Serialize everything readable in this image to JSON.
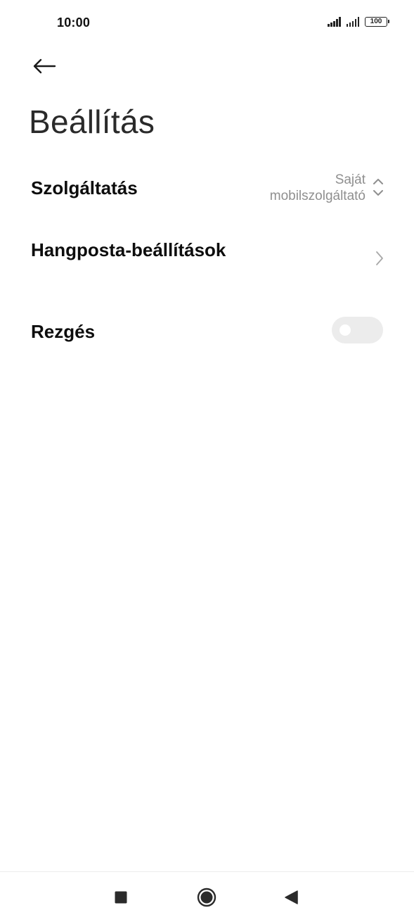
{
  "status_bar": {
    "time": "10:00",
    "battery": "100",
    "icons": [
      "signal-icon",
      "signal-icon",
      "battery-icon"
    ]
  },
  "header": {
    "back_icon": "arrow-left-icon",
    "title": "Beállítás"
  },
  "settings": {
    "service": {
      "label": "Szolgáltatás",
      "value_line1": "Saját",
      "value_line2": "mobilszolgáltató",
      "icon": "chevron-up-down-icon"
    },
    "voicemail": {
      "label": "Hangposta-beállítások",
      "icon": "chevron-right-icon"
    },
    "vibration": {
      "label": "Rezgés",
      "enabled": false
    }
  },
  "nav_bar": {
    "icons": [
      "recents-square-icon",
      "home-circle-icon",
      "back-triangle-icon"
    ]
  },
  "colors": {
    "background": "#ffffff",
    "text_primary": "#0d0d0d",
    "text_secondary": "#8f8f8f",
    "toggle_off": "#ececec"
  }
}
